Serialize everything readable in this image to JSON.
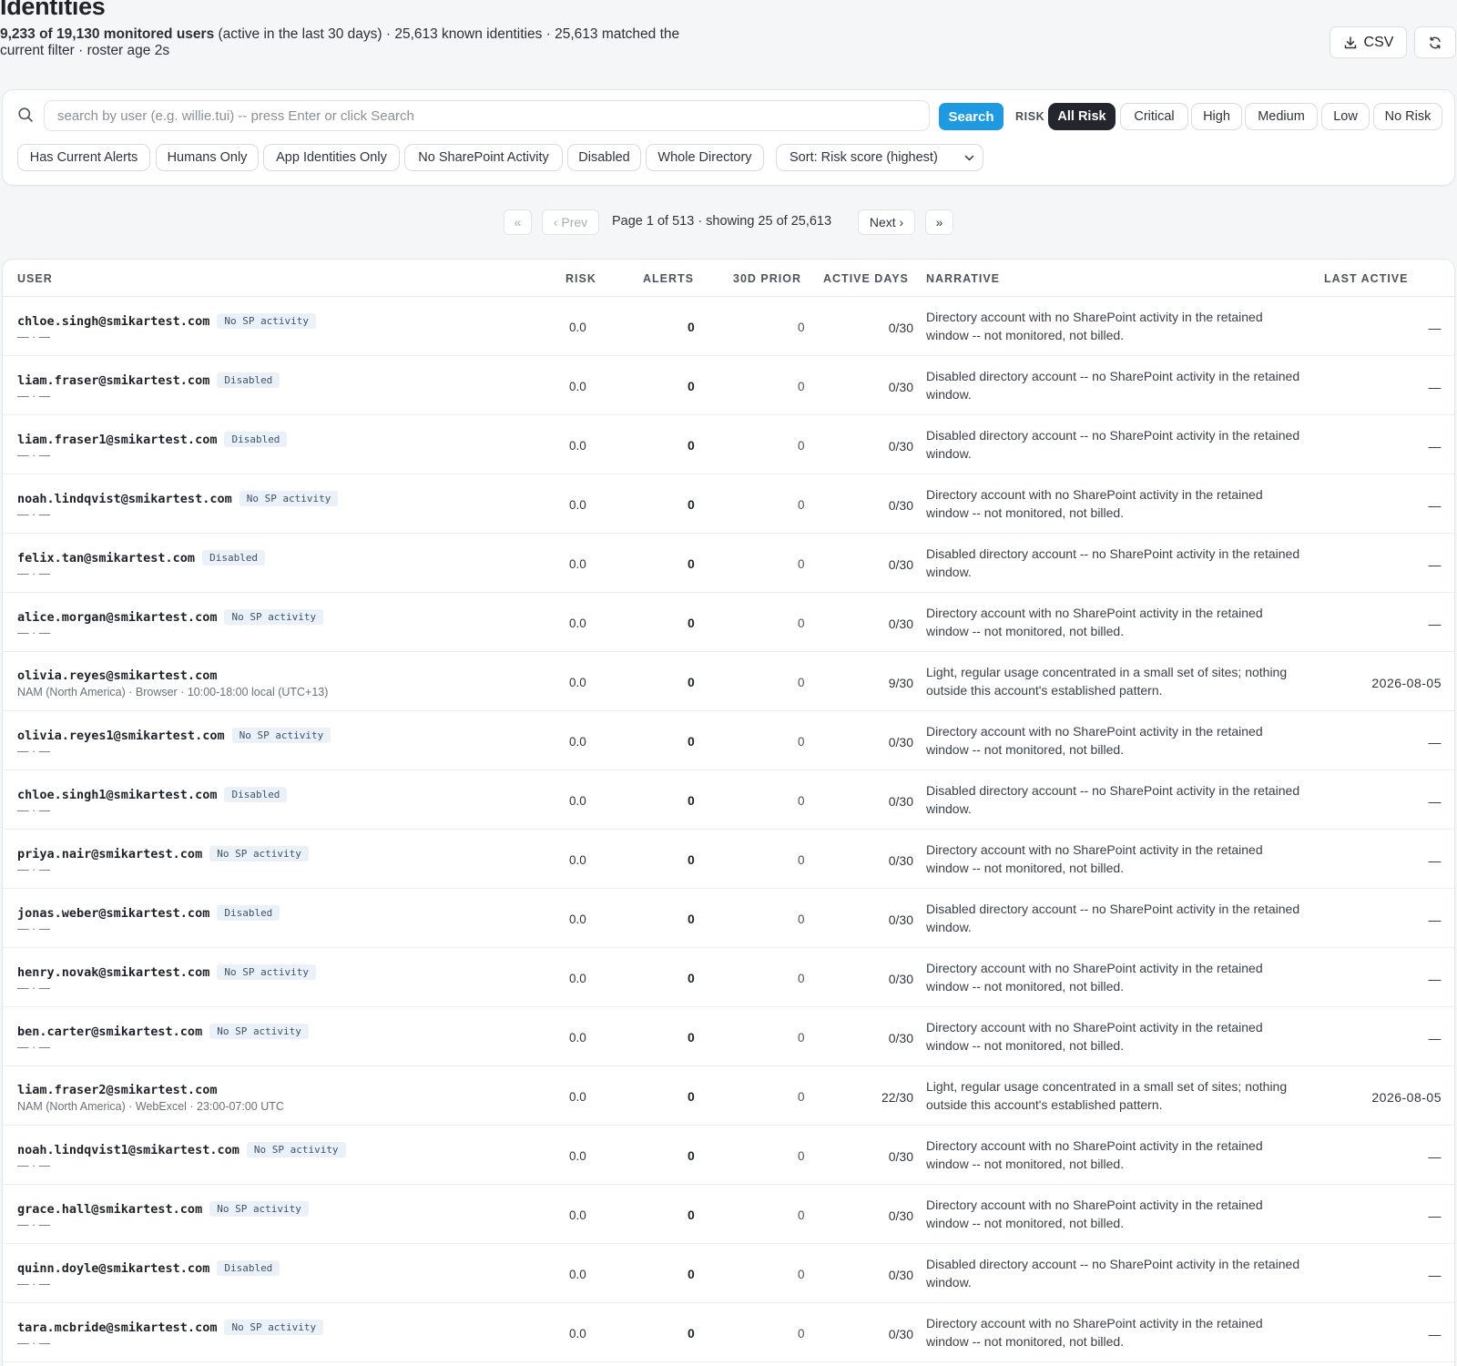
{
  "header": {
    "title": "Identities",
    "summary_bold": "9,233 of 19,130 monitored users",
    "summary_rest": " (active in the last 30 days) · 25,613 known identities · 25,613 matched the current filter · roster age 2s",
    "csv_label": "CSV"
  },
  "search": {
    "placeholder": "search by user (e.g. willie.tui) -- press Enter or click Search",
    "value": "",
    "button_label": "Search"
  },
  "risk_filter": {
    "label": "RISK",
    "options": [
      "All Risk",
      "Critical",
      "High",
      "Medium",
      "Low",
      "No Risk"
    ],
    "selected": "All Risk"
  },
  "quick_filters": [
    "Has Current Alerts",
    "Humans Only",
    "App Identities Only",
    "No SharePoint Activity",
    "Disabled",
    "Whole Directory"
  ],
  "sort": {
    "label": "Sort: Risk score (highest)"
  },
  "pagination": {
    "first": "«",
    "prev": "‹ Prev",
    "info": "Page 1 of 513 · showing 25 of 25,613",
    "next": "Next ›",
    "last": "»"
  },
  "table": {
    "columns": [
      "USER",
      "RISK",
      "ALERTS",
      "30D PRIOR",
      "ACTIVE DAYS",
      "NARRATIVE",
      "LAST ACTIVE"
    ],
    "rows": [
      {
        "user": "chloe.singh@smikartest.com",
        "badge": "No SP activity",
        "sub": "— · —",
        "risk": "0.0",
        "alerts": "0",
        "prior": "0",
        "days": "0/30",
        "narrative": "Directory account with no SharePoint activity in the retained window -- not monitored, not billed.",
        "last": "—"
      },
      {
        "user": "liam.fraser@smikartest.com",
        "badge": "Disabled",
        "sub": "— · —",
        "risk": "0.0",
        "alerts": "0",
        "prior": "0",
        "days": "0/30",
        "narrative": "Disabled directory account -- no SharePoint activity in the retained window.",
        "last": "—"
      },
      {
        "user": "liam.fraser1@smikartest.com",
        "badge": "Disabled",
        "sub": "— · —",
        "risk": "0.0",
        "alerts": "0",
        "prior": "0",
        "days": "0/30",
        "narrative": "Disabled directory account -- no SharePoint activity in the retained window.",
        "last": "—"
      },
      {
        "user": "noah.lindqvist@smikartest.com",
        "badge": "No SP activity",
        "sub": "— · —",
        "risk": "0.0",
        "alerts": "0",
        "prior": "0",
        "days": "0/30",
        "narrative": "Directory account with no SharePoint activity in the retained window -- not monitored, not billed.",
        "last": "—"
      },
      {
        "user": "felix.tan@smikartest.com",
        "badge": "Disabled",
        "sub": "— · —",
        "risk": "0.0",
        "alerts": "0",
        "prior": "0",
        "days": "0/30",
        "narrative": "Disabled directory account -- no SharePoint activity in the retained window.",
        "last": "—"
      },
      {
        "user": "alice.morgan@smikartest.com",
        "badge": "No SP activity",
        "sub": "— · —",
        "risk": "0.0",
        "alerts": "0",
        "prior": "0",
        "days": "0/30",
        "narrative": "Directory account with no SharePoint activity in the retained window -- not monitored, not billed.",
        "last": "—"
      },
      {
        "user": "olivia.reyes@smikartest.com",
        "badge": "",
        "sub": "NAM (North America) · Browser · 10:00-18:00 local (UTC+13)",
        "risk": "0.0",
        "alerts": "0",
        "prior": "0",
        "days": "9/30",
        "narrative": "Light, regular usage concentrated in a small set of sites; nothing outside this account's established pattern.",
        "last": "2026-08-05"
      },
      {
        "user": "olivia.reyes1@smikartest.com",
        "badge": "No SP activity",
        "sub": "— · —",
        "risk": "0.0",
        "alerts": "0",
        "prior": "0",
        "days": "0/30",
        "narrative": "Directory account with no SharePoint activity in the retained window -- not monitored, not billed.",
        "last": "—"
      },
      {
        "user": "chloe.singh1@smikartest.com",
        "badge": "Disabled",
        "sub": "— · —",
        "risk": "0.0",
        "alerts": "0",
        "prior": "0",
        "days": "0/30",
        "narrative": "Disabled directory account -- no SharePoint activity in the retained window.",
        "last": "—"
      },
      {
        "user": "priya.nair@smikartest.com",
        "badge": "No SP activity",
        "sub": "— · —",
        "risk": "0.0",
        "alerts": "0",
        "prior": "0",
        "days": "0/30",
        "narrative": "Directory account with no SharePoint activity in the retained window -- not monitored, not billed.",
        "last": "—"
      },
      {
        "user": "jonas.weber@smikartest.com",
        "badge": "Disabled",
        "sub": "— · —",
        "risk": "0.0",
        "alerts": "0",
        "prior": "0",
        "days": "0/30",
        "narrative": "Disabled directory account -- no SharePoint activity in the retained window.",
        "last": "—"
      },
      {
        "user": "henry.novak@smikartest.com",
        "badge": "No SP activity",
        "sub": "— · —",
        "risk": "0.0",
        "alerts": "0",
        "prior": "0",
        "days": "0/30",
        "narrative": "Directory account with no SharePoint activity in the retained window -- not monitored, not billed.",
        "last": "—"
      },
      {
        "user": "ben.carter@smikartest.com",
        "badge": "No SP activity",
        "sub": "— · —",
        "risk": "0.0",
        "alerts": "0",
        "prior": "0",
        "days": "0/30",
        "narrative": "Directory account with no SharePoint activity in the retained window -- not monitored, not billed.",
        "last": "—"
      },
      {
        "user": "liam.fraser2@smikartest.com",
        "badge": "",
        "sub": "NAM (North America) · WebExcel · 23:00-07:00 UTC",
        "risk": "0.0",
        "alerts": "0",
        "prior": "0",
        "days": "22/30",
        "narrative": "Light, regular usage concentrated in a small set of sites; nothing outside this account's established pattern.",
        "last": "2026-08-05"
      },
      {
        "user": "noah.lindqvist1@smikartest.com",
        "badge": "No SP activity",
        "sub": "— · —",
        "risk": "0.0",
        "alerts": "0",
        "prior": "0",
        "days": "0/30",
        "narrative": "Directory account with no SharePoint activity in the retained window -- not monitored, not billed.",
        "last": "—"
      },
      {
        "user": "grace.hall@smikartest.com",
        "badge": "No SP activity",
        "sub": "— · —",
        "risk": "0.0",
        "alerts": "0",
        "prior": "0",
        "days": "0/30",
        "narrative": "Directory account with no SharePoint activity in the retained window -- not monitored, not billed.",
        "last": "—"
      },
      {
        "user": "quinn.doyle@smikartest.com",
        "badge": "Disabled",
        "sub": "— · —",
        "risk": "0.0",
        "alerts": "0",
        "prior": "0",
        "days": "0/30",
        "narrative": "Disabled directory account -- no SharePoint activity in the retained window.",
        "last": "—"
      },
      {
        "user": "tara.mcbride@smikartest.com",
        "badge": "No SP activity",
        "sub": "— · —",
        "risk": "0.0",
        "alerts": "0",
        "prior": "0",
        "days": "0/30",
        "narrative": "Directory account with no SharePoint activity in the retained window -- not monitored, not billed.",
        "last": "—"
      }
    ]
  },
  "icons": {
    "search": "search-icon",
    "csv": "download-icon",
    "refresh": "refresh-icon",
    "sort": "chevron-down-icon"
  }
}
